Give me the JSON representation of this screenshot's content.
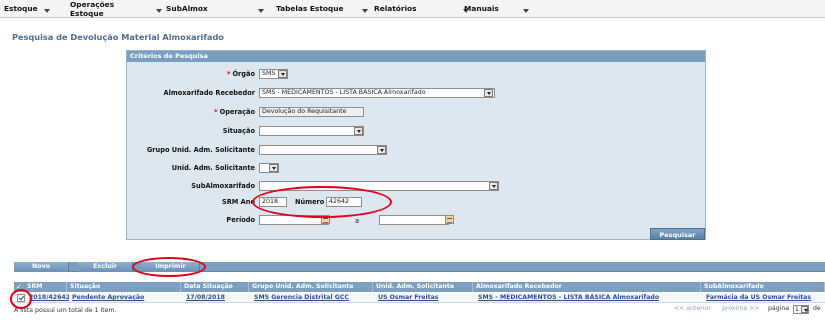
{
  "menu": {
    "items": [
      {
        "label": "Estoque"
      },
      {
        "label": "Operações Estoque"
      },
      {
        "label": "SubAlmox"
      },
      {
        "label": "Tabelas Estoque"
      },
      {
        "label": "Relatórios"
      },
      {
        "label": "Manuais"
      }
    ]
  },
  "page": {
    "title": "Pesquisa de Devolução Material Almoxarifado"
  },
  "criteria": {
    "heading": "Critérios de Pesquisa",
    "orgao": {
      "label": "Órgão",
      "value": "SMS"
    },
    "almoxarifado_recebedor": {
      "label": "Almoxarifado Recebedor",
      "value": "SMS - MEDICAMENTOS - LISTA BÁSICA Almoxarifado"
    },
    "operacao": {
      "label": "Operação",
      "value": "Devolução do Requisitante"
    },
    "situacao": {
      "label": "Situação",
      "value": ""
    },
    "grupo_unid": {
      "label": "Grupo Unid. Adm. Solicitante",
      "value": ""
    },
    "unid_adm": {
      "label": "Unid. Adm. Solicitante",
      "value": ""
    },
    "subalmoxarifado": {
      "label": "SubAlmoxarifado",
      "value": ""
    },
    "srm_ano": {
      "label": "SRM Ano",
      "value": "2018"
    },
    "numero": {
      "label": "Número",
      "value": "42642"
    },
    "periodo": {
      "label": "Período",
      "separator": "a",
      "start": "",
      "end": ""
    },
    "search_button": "Pesquisar",
    "required_mark": "*"
  },
  "toolbar": {
    "novo": "Novo",
    "excluir": "Excluir",
    "imprimir": "Imprimir"
  },
  "table": {
    "headers": [
      "SRM",
      "Situação",
      "Data Situação",
      "Grupo Unid. Adm. Solicitante",
      "Unid. Adm. Solicitante",
      "Almoxarifado Recebedor",
      "SubAlmoxarifado"
    ],
    "select_all_mark": "✓",
    "rows": [
      {
        "srm": "2018/42642",
        "situacao": "Pendente Aprovação",
        "data": "17/08/2018",
        "grupo": "SMS Gerencia Distrital GCC",
        "unid": "US Osmar Freitas",
        "almox": "SMS - MEDICAMENTOS - LISTA BÁSICA Almoxarifado",
        "sub": "Farmácia da US Osmar Freitas",
        "checked": true
      }
    ]
  },
  "footer": {
    "summary": "A lista possui um total de 1 item.",
    "anterior": "<< anterior",
    "proxima": "próxima >>",
    "pagina_label": "página",
    "pagina_value": "1",
    "de_label": "de"
  },
  "colors": {
    "header_blue": "#7a9ec0",
    "title_blue": "#4e6d8c",
    "annotation_red": "#e0001a"
  }
}
